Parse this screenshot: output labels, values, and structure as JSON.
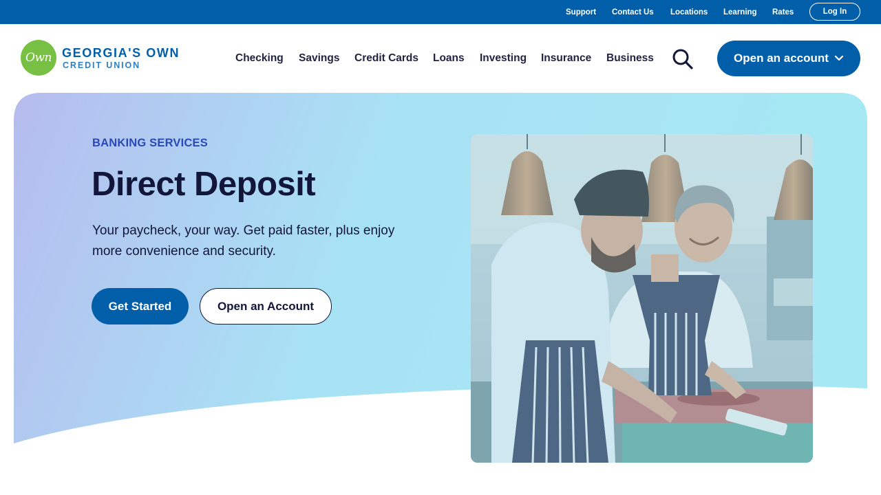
{
  "utility_nav": {
    "links": [
      "Support",
      "Contact Us",
      "Locations",
      "Learning",
      "Rates"
    ],
    "login_label": "Log In"
  },
  "brand": {
    "logo_mark": "Own",
    "name_line1": "GEORGIA'S OWN",
    "name_line2": "CREDIT UNION"
  },
  "main_nav": {
    "items": [
      "Checking",
      "Savings",
      "Credit Cards",
      "Loans",
      "Investing",
      "Insurance",
      "Business"
    ],
    "search_icon": "search-icon",
    "cta_label": "Open an account",
    "cta_icon": "chevron-down-icon"
  },
  "hero": {
    "eyebrow": "BANKING SERVICES",
    "title": "Direct Deposit",
    "description": "Your paycheck, your way. Get paid faster, plus enjoy more convenience and security.",
    "primary_button": "Get Started",
    "secondary_button": "Open an Account",
    "image_alt": "Two chefs preparing food in a kitchen"
  },
  "colors": {
    "brand_blue": "#015ea8",
    "brand_green": "#78c043",
    "text_dark": "#12163a",
    "eyebrow_blue": "#2a49b8",
    "gradient_start": "#b6bcee",
    "gradient_end": "#a6e8f4"
  }
}
